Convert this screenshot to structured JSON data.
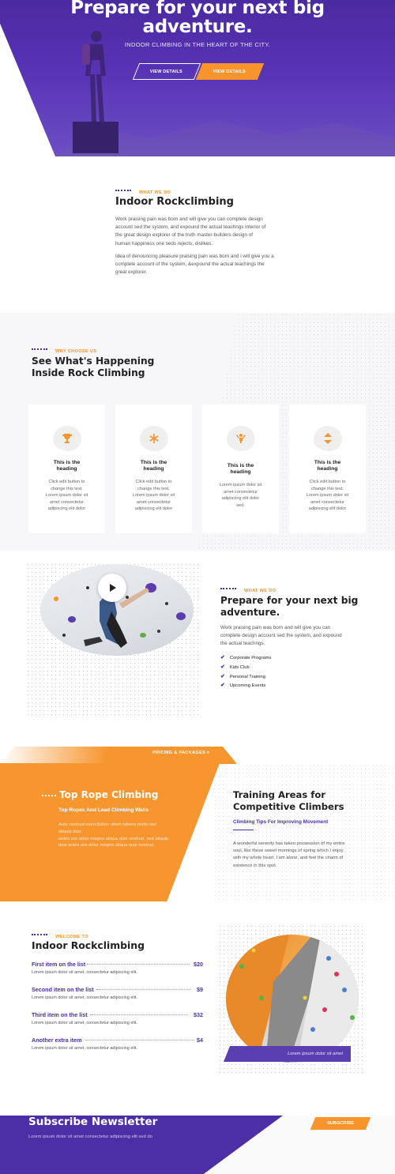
{
  "hero": {
    "title_line1": "Prepare for your next big",
    "title_line2": "adventure.",
    "subtitle": "INDOOR CLIMBING IN THE HEART OF THE CITY.",
    "btn1": "VIEW DETAILS",
    "btn2": "VIEW DETAILS"
  },
  "about": {
    "eyebrow": "WHAT WE DO",
    "title": "Indoor Rockclimbing",
    "p1_l1": "Work praising pain was born and will give you can complete design",
    "p1_l2": "account sed the system, and expound the actual teachngs interior of",
    "p1_l3": "the great design explorer of the truth master-builders design of",
    "p1_l4": "human happiness one seds rejects, dislikes.",
    "p2_l1": "Idea of denouncing pleasure praising pain was born and i will give you a",
    "p2_l2": "complete account of the system, &expound the actual teachings the",
    "p2_l3": "great explorer."
  },
  "why": {
    "eyebrow": "WHY CHOOSE US",
    "title_l1": "See What's Happening",
    "title_l2": "Inside Rock Climbing",
    "cards": [
      {
        "icon": "trophy-icon",
        "glyph": "🏆",
        "t1": "This is the",
        "t2": "heading",
        "l1": "Click edit button to",
        "l2": "change this text.",
        "l3": "Lorem ipsum dolor sit",
        "l4": "amet consectetur",
        "l5": "adipiscing elit dolor"
      },
      {
        "icon": "snowflake-icon",
        "glyph": "❄",
        "t1": "This is the",
        "t2": "heading",
        "l1": "Click edit button to",
        "l2": "change this text.",
        "l3": "Lorem ipsum dolor sit",
        "l4": "amet consectetur",
        "l5": "adipiscing elit dolor"
      },
      {
        "icon": "person-icon",
        "glyph": "🙋",
        "t1": "This is the",
        "t2": "heading",
        "l1": "Lorem ipsum dolor sit",
        "l2": "amet consectetur",
        "l3": "adipiscing elit dolor",
        "l4": "sed.",
        "l5": ""
      },
      {
        "icon": "arrows-updown-icon",
        "glyph": "⬍",
        "t1": "This is the",
        "t2": "heading",
        "l1": "Click edit button to",
        "l2": "change this text.",
        "l3": "Lorem ipsum dolor sit",
        "l4": "amet consectetur",
        "l5": "adipiscing elit dolor"
      }
    ]
  },
  "video": {
    "eyebrow": "WHAT WE DO",
    "title_l1": "Prepare for your next big",
    "title_l2": "adventure.",
    "p_l1": "Work praising pain was born and will give you can",
    "p_l2": "complete design account sed the system, and expound",
    "p_l3": "the actual teachngs.",
    "checks": [
      "Corporate Programs",
      "Kids Club",
      "Personal Training",
      "Upcoming Events"
    ]
  },
  "pricing": {
    "tab": "PRICING & PACKAGES",
    "title": "Top Rope Climbing",
    "subtitle": "Top Ropes And Lead Climbing Walls",
    "l1": "Aute nostrud exercitation ullam laboris nisitn sed",
    "l2": "aliquip duis",
    "l3": "autes ure dolor magna aliqua quis nostrud. sed aliquip",
    "l4": "duis autes ure dolor magna aliqua quis nostrud.",
    "right_title_l1": "Training Areas for",
    "right_title_l2": "Competitive Climbers",
    "right_sub": "Climbing Tips For Improving Movement",
    "right_l1": "A wonderful serenity has taken possession of my entire",
    "right_l2": "soul, like these sweet mornings of spring which I enjoy",
    "right_l3": "with my whole heart. I am alone, and feel the charm of",
    "right_l4": "existence in this spot."
  },
  "menu": {
    "eyebrow": "WELCOME TO",
    "title": "Indoor Rockclimbing",
    "items": [
      {
        "name": "First item on the list",
        "price": "$20",
        "desc": "Lorem ipsum dolor sit amet, consectetur adipiscing elit."
      },
      {
        "name": "Second item on the list",
        "price": "$9",
        "desc": "Lorem ipsum dolor sit amet, consectetur adipiscing elit."
      },
      {
        "name": "Third item on the list",
        "price": "$32",
        "desc": "Lorem ipsum dolor sit amet, consectetur adipiscing elit."
      },
      {
        "name": "Another extra item",
        "price": "$4",
        "desc": "Lorem ipsum dolor sit amet, consectetur adipiscing elit."
      }
    ],
    "caption": "Lorem ipsum dolor sit amet"
  },
  "subscribe": {
    "title": "Subscribe Newsletter",
    "text": "Lorem ipsum dolor sit amet consectetur adipiscing elit sed do",
    "button": "SUBSCRIBE"
  },
  "colors": {
    "purple": "#4c2ea6",
    "orange": "#f7942c"
  }
}
